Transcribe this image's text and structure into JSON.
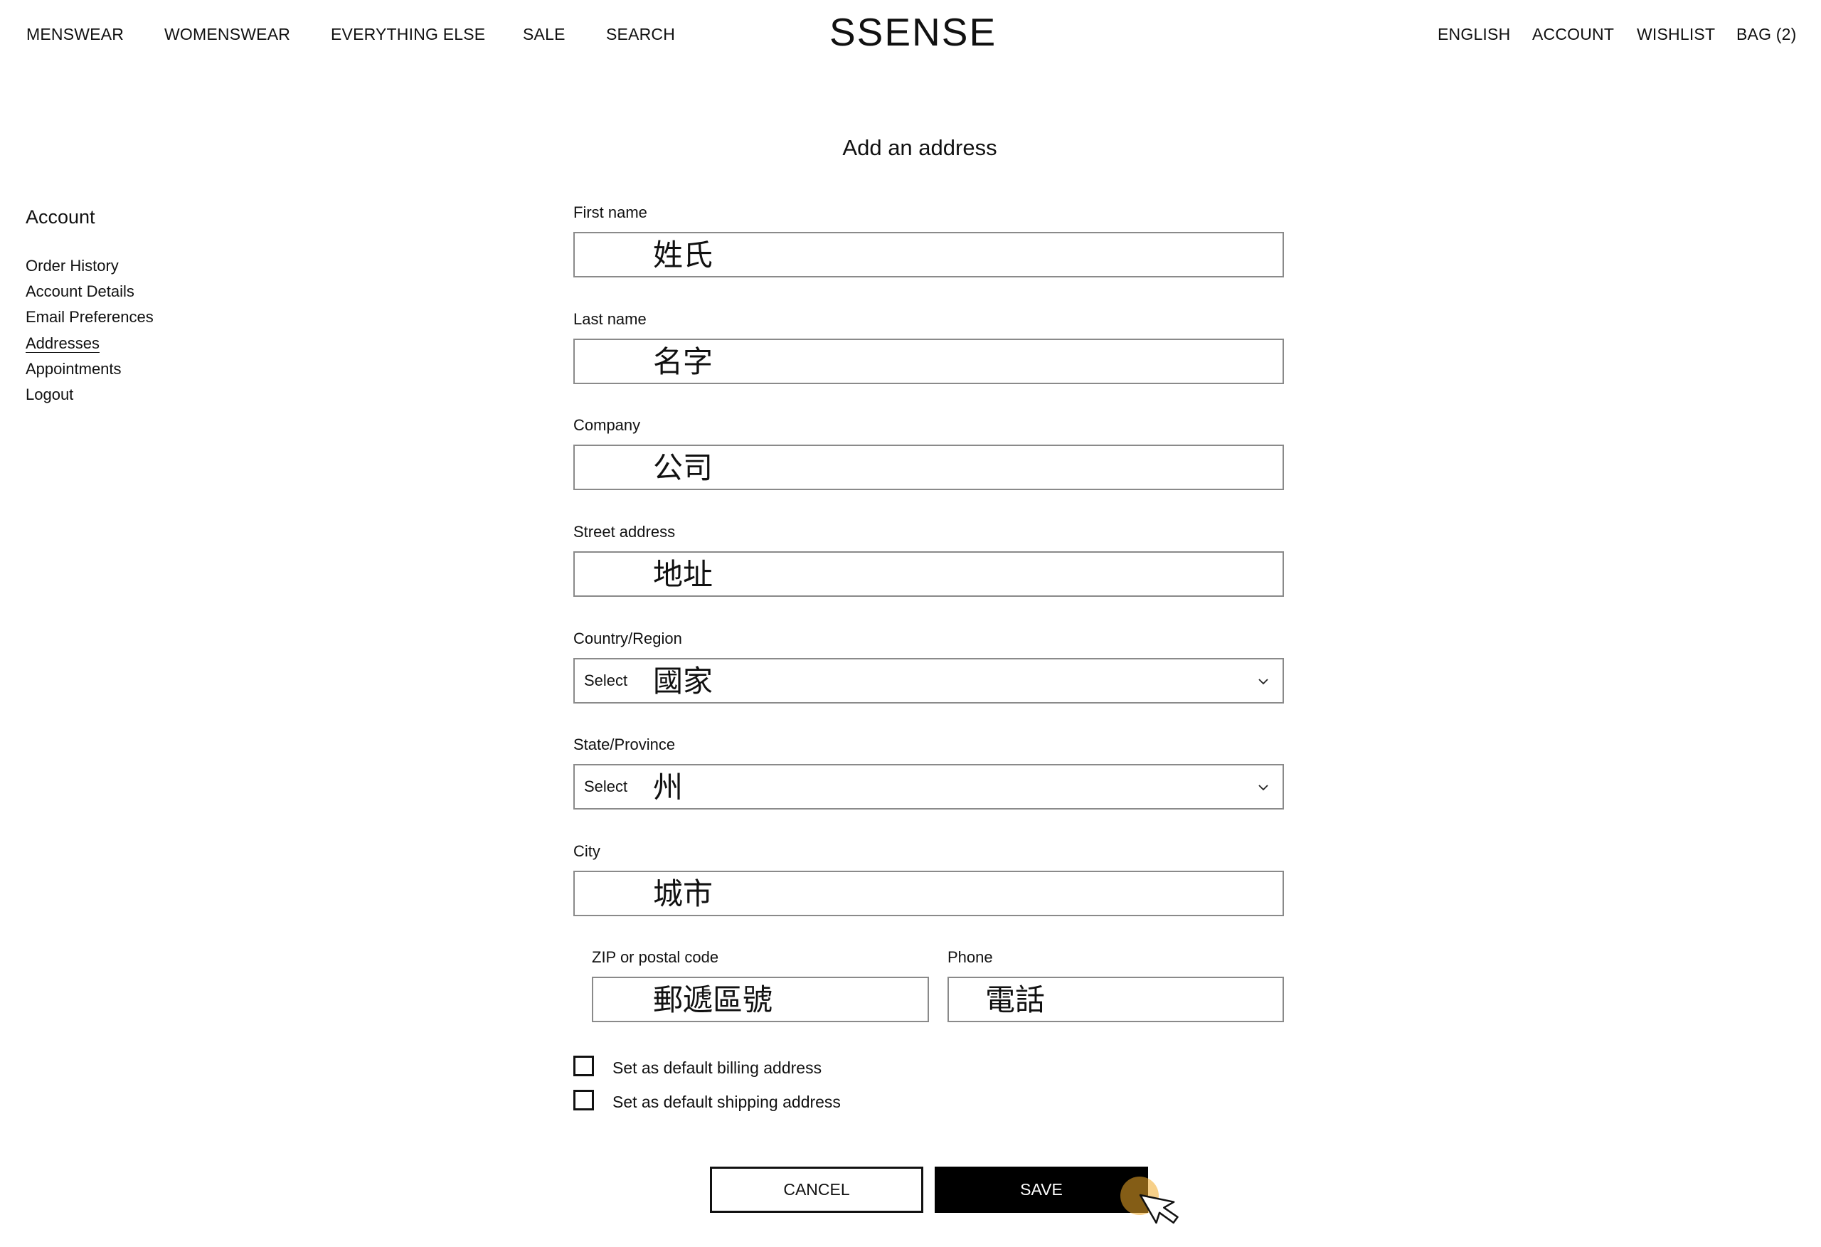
{
  "nav": {
    "left": [
      {
        "id": "menswear",
        "label": "MENSWEAR"
      },
      {
        "id": "womenswear",
        "label": "WOMENSWEAR"
      },
      {
        "id": "everything-else",
        "label": "EVERYTHING ELSE"
      },
      {
        "id": "sale",
        "label": "SALE"
      },
      {
        "id": "search",
        "label": "SEARCH"
      }
    ],
    "logo": "SSENSE",
    "right": [
      {
        "id": "english",
        "label": "ENGLISH"
      },
      {
        "id": "account",
        "label": "ACCOUNT"
      },
      {
        "id": "wishlist",
        "label": "WISHLIST"
      },
      {
        "id": "bag",
        "label": "BAG (2)"
      }
    ]
  },
  "page": {
    "title": "Add an address"
  },
  "sidebar": {
    "heading": "Account",
    "items": [
      {
        "label": "Order History",
        "active": false
      },
      {
        "label": "Account Details",
        "active": false
      },
      {
        "label": "Email Preferences",
        "active": false
      },
      {
        "label": "Addresses",
        "active": true
      },
      {
        "label": "Appointments",
        "active": false
      },
      {
        "label": "Logout",
        "active": false
      }
    ]
  },
  "form": {
    "first_name": {
      "label": "First name",
      "value": "姓氏"
    },
    "last_name": {
      "label": "Last name",
      "value": "名字"
    },
    "company": {
      "label": "Company",
      "value": "公司"
    },
    "street": {
      "label": "Street address",
      "value": "地址"
    },
    "country": {
      "label": "Country/Region",
      "prefix": "Select",
      "value": "國家",
      "icon": "chevron-down-icon"
    },
    "state": {
      "label": "State/Province",
      "prefix": "Select",
      "value": "州",
      "icon": "chevron-down-icon"
    },
    "city": {
      "label": "City",
      "value": "城市"
    },
    "zip": {
      "label": "ZIP or postal code",
      "value": "郵遞區號"
    },
    "phone": {
      "label": "Phone",
      "value": "電話"
    },
    "checkboxes": [
      {
        "label": "Set as default billing address",
        "checked": false
      },
      {
        "label": "Set as default shipping address",
        "checked": false
      }
    ],
    "cancel_label": "CANCEL",
    "save_label": "SAVE"
  },
  "colors": {
    "text": "#111111",
    "input_border": "#8a8a8a",
    "primary_button": "#000000",
    "cursor_highlight": "#f0aa28"
  }
}
